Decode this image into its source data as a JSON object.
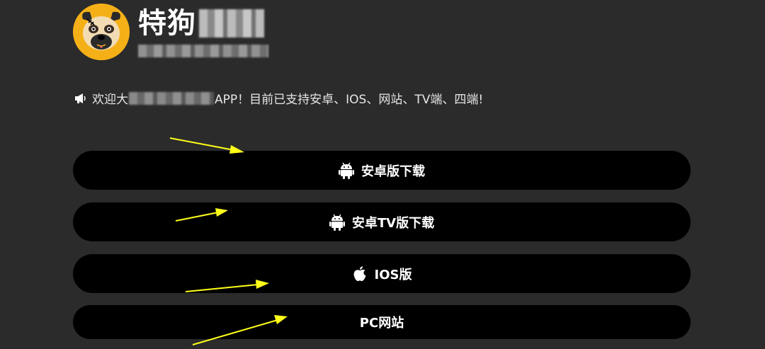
{
  "header": {
    "title": "特狗",
    "logo_icon": "pug-dog-icon"
  },
  "notice": {
    "icon": "megaphone-icon",
    "text_start": "欢迎大",
    "text_end": "APP！目前已支持安卓、IOS、网站、TV端、四端!"
  },
  "buttons": [
    {
      "label": "安卓版下载",
      "icon": "android-icon"
    },
    {
      "label": "安卓TV版下载",
      "icon": "android-icon"
    },
    {
      "label": "IOS版",
      "icon": "apple-icon"
    },
    {
      "label": "PC网站",
      "icon": ""
    }
  ],
  "colors": {
    "background": "#2b2b2b",
    "button": "#000000",
    "accent_arrow": "#ffff1a",
    "logo_bg": "#f5b018"
  }
}
